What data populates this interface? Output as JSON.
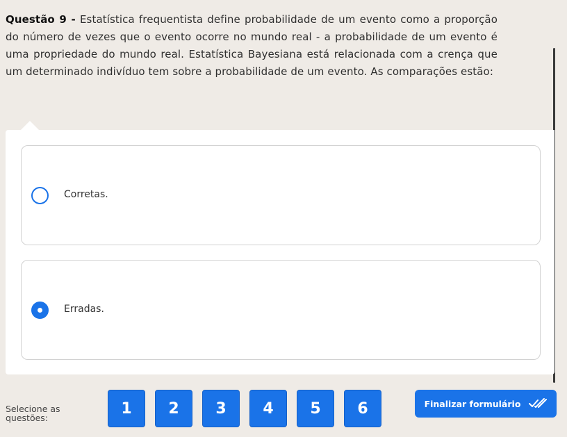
{
  "question": {
    "number": "Questão 9 -",
    "text": "Estatística frequentista define probabilidade de um evento como a proporção do número de vezes que o evento ocorre no mundo real - a probabilidade de um evento é uma propriedade do mundo real. Estatística Bayesiana está relacionada com a crença que um determinado indivíduo tem sobre a probabilidade de um evento. As comparações estão:"
  },
  "options": [
    {
      "label": "Corretas.",
      "selected": false
    },
    {
      "label": "Erradas.",
      "selected": true
    }
  ],
  "footer": {
    "select_label": "Selecione as questões:",
    "question_buttons": [
      "1",
      "2",
      "3",
      "4",
      "5",
      "6"
    ],
    "finish_label": "Finalizar formulário",
    "finish_icon": "double-check-icon"
  },
  "colors": {
    "accent": "#1a73e8",
    "background": "#efebe6"
  }
}
